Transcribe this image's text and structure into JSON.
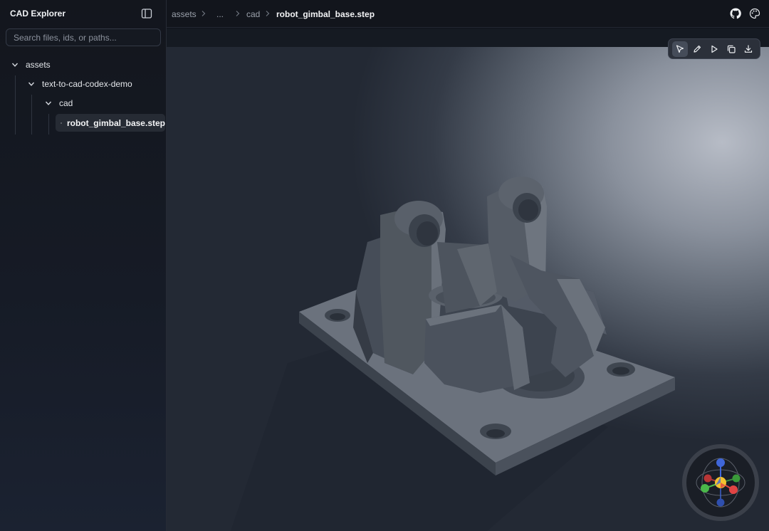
{
  "sidebar": {
    "title": "CAD Explorer",
    "toggle_icon": "sidebar-toggle-icon",
    "search_placeholder": "Search files, ids, or paths...",
    "search_value": "",
    "tree": {
      "root": "assets",
      "folder": "text-to-cad-codex-demo",
      "subfolder": "cad",
      "file": "robot_gimbal_base.step",
      "file_icon": "cube-icon"
    }
  },
  "breadcrumb": {
    "items": [
      "assets",
      "...",
      "cad",
      "robot_gimbal_base.step"
    ]
  },
  "top_icons": [
    "github-icon",
    "palette-icon"
  ],
  "toolbar": {
    "buttons": [
      "select-cursor-icon",
      "annotate-pen-icon",
      "play-icon",
      "copy-icon",
      "download-icon"
    ],
    "active": "select-cursor-icon"
  },
  "gizmo": {
    "axes": [
      "x",
      "y",
      "z"
    ],
    "colors": {
      "x": "#e24444",
      "y": "#4ab84a",
      "z": "#3f66d9",
      "center": "#f2c230"
    }
  },
  "colors": {
    "accent": "#f1f3f6",
    "model": "#4f5661"
  }
}
